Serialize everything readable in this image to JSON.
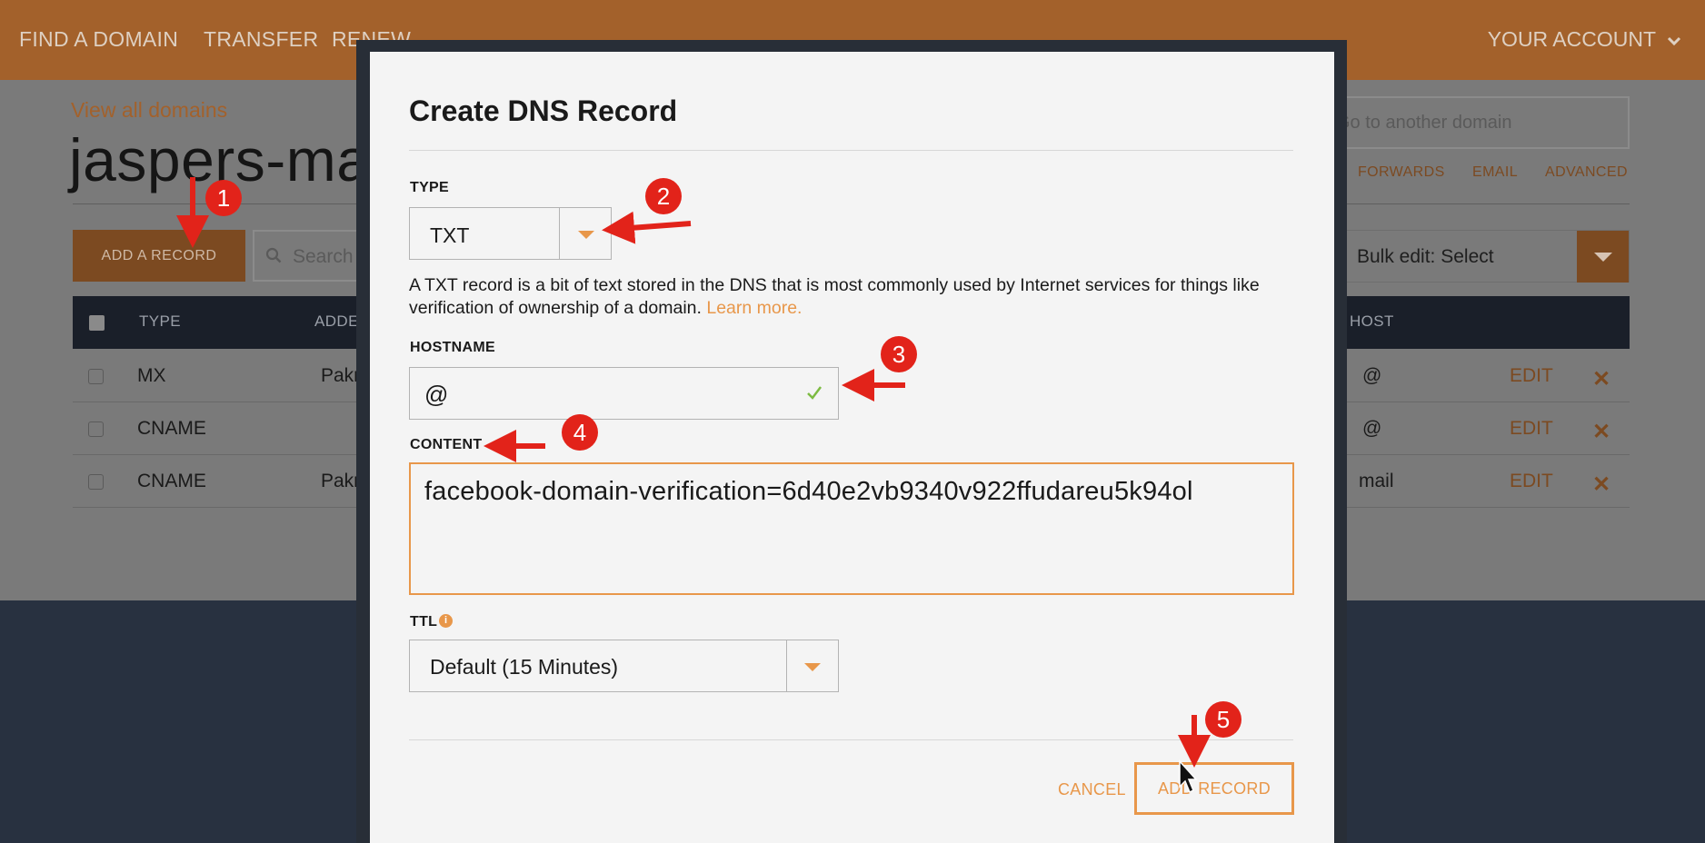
{
  "topnav": {
    "find_domain": "FIND A DOMAIN",
    "transfer": "TRANSFER",
    "renew": "RENEW",
    "account": "YOUR ACCOUNT"
  },
  "page": {
    "view_all": "View all domains",
    "domain_title": "jaspers-ma",
    "goto_placeholder": "Go to another domain",
    "subnav": [
      "FORWARDS",
      "EMAIL",
      "ADVANCED"
    ],
    "add_record_label": "ADD A RECORD",
    "search_placeholder": "Search",
    "bulk_edit": "Bulk edit: Select",
    "table": {
      "headers": [
        "TYPE",
        "ADDE",
        "HOST"
      ],
      "rows": [
        {
          "type": "MX",
          "address": "Pakr",
          "host": "@",
          "edit": "EDIT"
        },
        {
          "type": "CNAME",
          "address": "",
          "host": "@",
          "edit": "EDIT"
        },
        {
          "type": "CNAME",
          "address": "Pakr",
          "host": "mail",
          "edit": "EDIT"
        }
      ]
    }
  },
  "modal": {
    "title": "Create DNS Record",
    "type_label": "TYPE",
    "type_value": "TXT",
    "description": "A TXT record is a bit of text stored in the DNS that is most commonly used by Internet services for things like verification of ownership of a domain.",
    "learn_more": "Learn more.",
    "hostname_label": "HOSTNAME",
    "hostname_value": "@",
    "content_label": "CONTENT",
    "content_value": "facebook-domain-verification=6d40e2vb9340v922ffudareu5k94ol",
    "ttl_label": "TTL",
    "ttl_info_icon": "i",
    "ttl_value": "Default (15 Minutes)",
    "cancel_label": "CANCEL",
    "add_record_label": "ADD RECORD"
  },
  "annotations": {
    "steps": [
      "1",
      "2",
      "3",
      "4",
      "5"
    ],
    "color": "#e2231a"
  },
  "colors": {
    "accent": "#e8974a",
    "nav_background": "#a3612b",
    "modal_background": "#f4f4f4"
  }
}
